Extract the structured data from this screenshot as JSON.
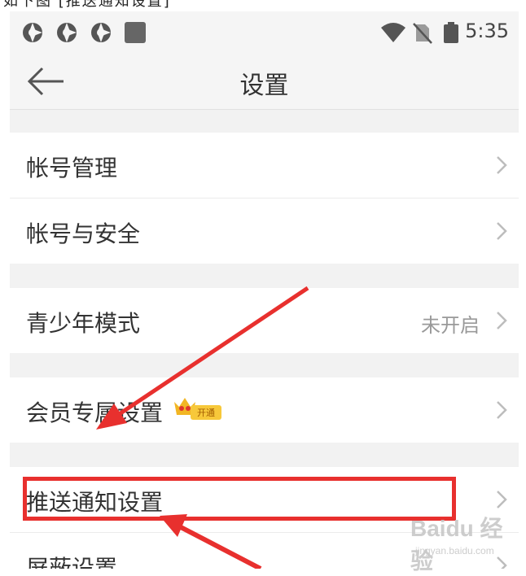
{
  "top_crop_text": "如下图 [推送通知设置]",
  "status_bar": {
    "time": "5:35",
    "icons": [
      "notification-icon",
      "notification-icon",
      "notification-icon",
      "square-icon",
      "wifi-icon",
      "no-sim-icon",
      "battery-icon"
    ]
  },
  "header": {
    "title": "设置",
    "back_icon": "arrow-left-icon"
  },
  "rows": [
    {
      "label": "帐号管理"
    },
    {
      "label": "帐号与安全"
    },
    {
      "label": "青少年模式",
      "value": "未开启"
    },
    {
      "label": "会员专属设置",
      "badge": "开通"
    },
    {
      "label": "推送通知设置"
    },
    {
      "label": "屏蔽设置"
    }
  ],
  "watermark": {
    "brand": "Baidu 经验",
    "url": "jingyan.baidu.com"
  },
  "colors": {
    "highlight": "#e8302e",
    "arrow": "#e8302e",
    "badge": "#f7c83a",
    "background": "#f2f2f2"
  }
}
